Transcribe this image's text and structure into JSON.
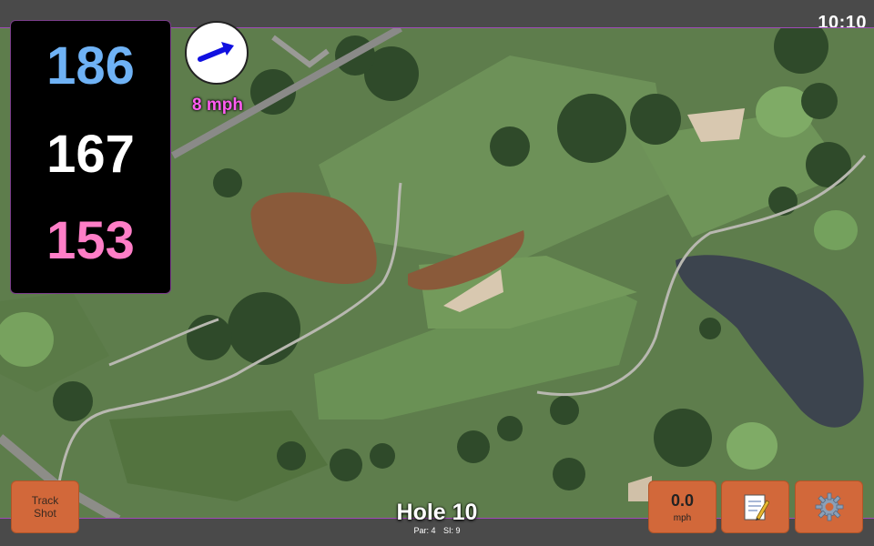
{
  "status": {
    "time": "10:10"
  },
  "distances": {
    "back": "186",
    "center": "167",
    "front": "153",
    "colors": {
      "back": "#6fb2f5",
      "center": "#ffffff",
      "front": "#ff7ec7"
    }
  },
  "wind": {
    "speed_label": "8 mph",
    "direction_icon": "arrow-icon",
    "arrow_color": "#1010e0"
  },
  "hole": {
    "title": "Hole 10",
    "par": "Par: 4",
    "stroke_index": "SI: 9"
  },
  "controls": {
    "track_shot": {
      "line1": "Track",
      "line2": "Shot"
    },
    "speed": {
      "value": "0.0",
      "unit": "mph"
    },
    "notes_icon": "notepad-icon",
    "settings_icon": "gear-icon"
  },
  "colors": {
    "button_bg": "#d2683a",
    "bar_bg": "#4a4a4a",
    "accent_border": "#a04ab8"
  }
}
